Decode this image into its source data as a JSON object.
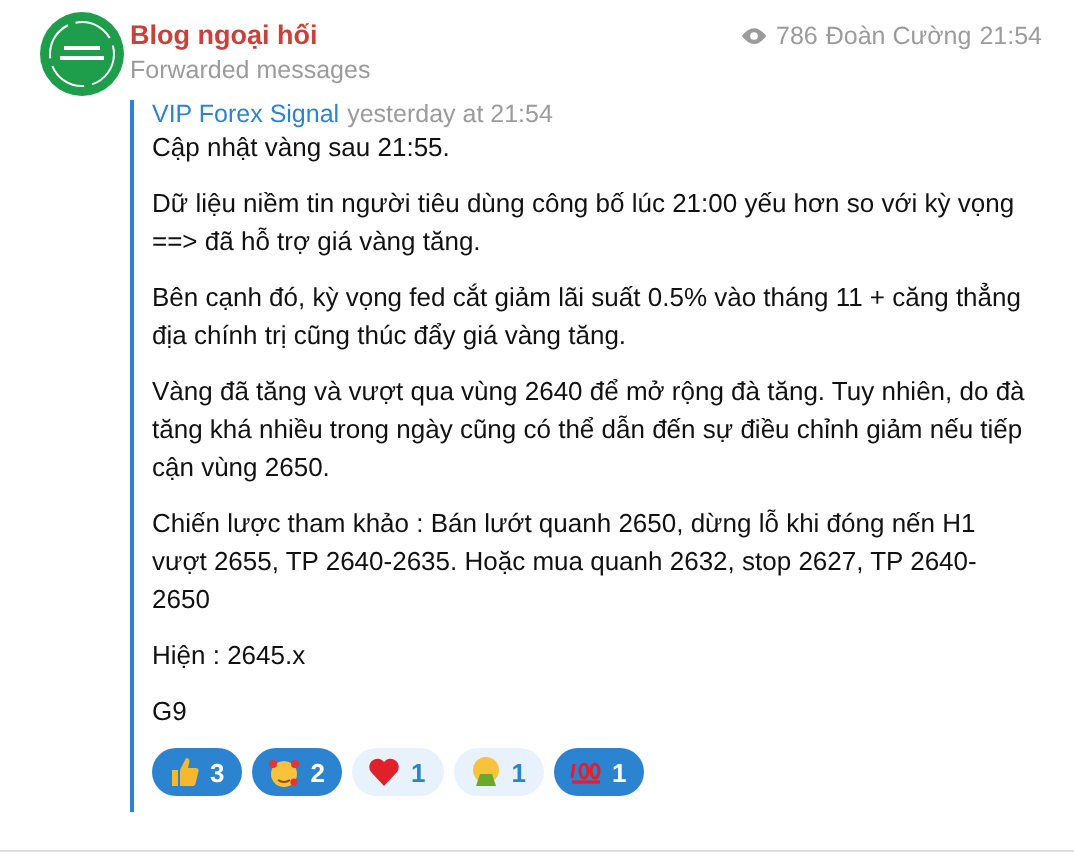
{
  "channel": {
    "name": "Blog ngoại hối",
    "subtitle": "Forwarded messages",
    "views": "786",
    "author": "Đoàn Cường",
    "time": "21:54"
  },
  "forward": {
    "source": "VIP Forex Signal",
    "time": "yesterday at 21:54"
  },
  "paragraphs": [
    "Cập nhật vàng sau 21:55.",
    "Dữ liệu niềm tin người tiêu dùng công bố lúc 21:00 yếu hơn so với kỳ vọng ==> đã hỗ trợ giá vàng tăng.",
    "Bên cạnh đó, kỳ vọng fed cắt giảm lãi suất 0.5% vào tháng 11 + căng thẳng địa chính trị cũng thúc đẩy giá vàng tăng.",
    "Vàng đã tăng và vượt qua vùng 2640 để mở rộng đà tăng. Tuy nhiên, do đà tăng khá nhiều trong ngày cũng có thể dẫn đến sự điều chỉnh giảm nếu tiếp cận vùng 2650.",
    "Chiến lược tham khảo : Bán lướt quanh 2650, dừng lỗ khi đóng nến H1 vượt 2655, TP 2640-2635. Hoặc mua quanh 2632, stop 2627, TP 2640-2650",
    "Hiện : 2645.x",
    "G9"
  ],
  "reactions": [
    {
      "kind": "thumbs-up",
      "count": "3",
      "selected": true
    },
    {
      "kind": "smiling-hearts",
      "count": "2",
      "selected": true
    },
    {
      "kind": "heart",
      "count": "1",
      "selected": false
    },
    {
      "kind": "vomiting",
      "count": "1",
      "selected": false
    },
    {
      "kind": "hundred",
      "count": "1",
      "selected": true
    }
  ]
}
